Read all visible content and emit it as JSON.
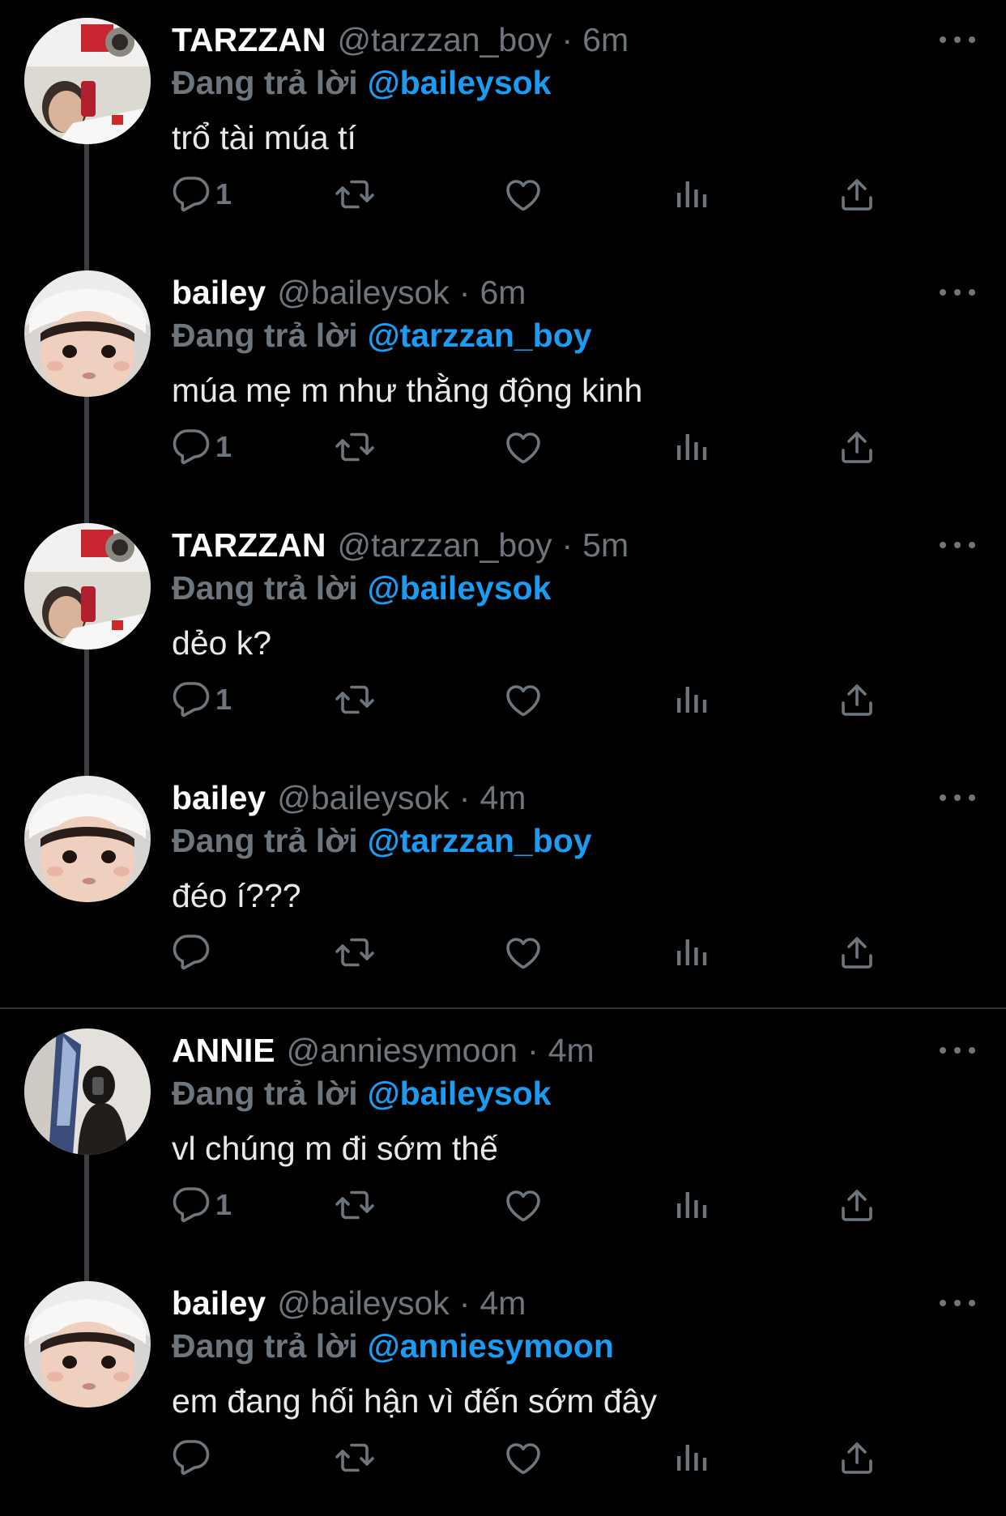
{
  "reply_prefix": "Đang trả lời",
  "colors": {
    "background": "#000000",
    "link": "#1d9bf0",
    "muted": "#6e767d",
    "text": "#e7e9ea"
  },
  "tweets": [
    {
      "name": "TARZZAN",
      "handle": "@tarzzan_boy",
      "separator": "·",
      "time": "6m",
      "reply_to": "@baileysok",
      "text": "trổ tài múa tí",
      "reply_count": "1"
    },
    {
      "name": "bailey",
      "handle": "@baileysok",
      "separator": "·",
      "time": "6m",
      "reply_to": "@tarzzan_boy",
      "text": "múa mẹ m như thằng động kinh",
      "reply_count": "1"
    },
    {
      "name": "TARZZAN",
      "handle": "@tarzzan_boy",
      "separator": "·",
      "time": "5m",
      "reply_to": "@baileysok",
      "text": "dẻo k?",
      "reply_count": "1"
    },
    {
      "name": "bailey",
      "handle": "@baileysok",
      "separator": "·",
      "time": "4m",
      "reply_to": "@tarzzan_boy",
      "text": "đéo í???",
      "reply_count": ""
    },
    {
      "name": "ANNIE",
      "handle": "@anniesymoon",
      "separator": "·",
      "time": "4m",
      "reply_to": "@baileysok",
      "text": "vl chúng m đi sớm thế",
      "reply_count": "1"
    },
    {
      "name": "bailey",
      "handle": "@baileysok",
      "separator": "·",
      "time": "4m",
      "reply_to": "@anniesymoon",
      "text": "em đang hối hận vì đến sớm đây",
      "reply_count": ""
    }
  ],
  "icons": [
    "reply-icon",
    "retweet-icon",
    "like-icon",
    "views-icon",
    "share-icon",
    "more-icon"
  ]
}
